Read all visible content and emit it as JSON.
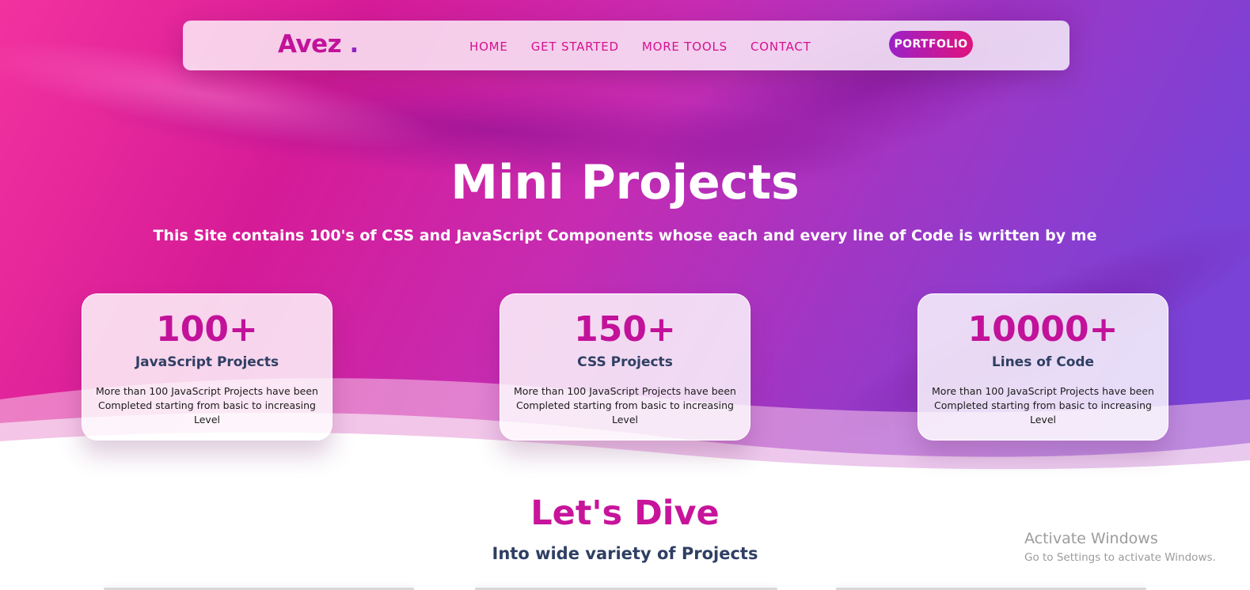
{
  "navbar": {
    "logo_text": "Avez",
    "logo_dot": ".",
    "links": [
      "HOME",
      "GET STARTED",
      "MORE TOOLS",
      "CONTACT"
    ],
    "portfolio_label": "PORTFOLIO"
  },
  "hero": {
    "title": "Mini Projects",
    "subtitle": "This Site contains 100's of CSS and JavaScript Components whose each and every line of Code is written by me"
  },
  "stats": [
    {
      "value": "100+",
      "title": "JavaScript Projects",
      "description": "More than 100 JavaScript Projects have been Completed starting from basic to increasing Level"
    },
    {
      "value": "150+",
      "title": "CSS Projects",
      "description": "More than 100 JavaScript Projects have been Completed starting from basic to increasing Level"
    },
    {
      "value": "10000+",
      "title": "Lines of Code",
      "description": "More than 100 JavaScript Projects have been Completed starting from basic to increasing Level"
    }
  ],
  "dive": {
    "title": "Let's Dive",
    "subtitle": "Into wide variety of Projects"
  },
  "watermark": {
    "title": "Activate Windows",
    "subtitle": "Go to Settings to activate Windows."
  },
  "colors": {
    "accent_pink": "#c2129a",
    "accent_purple": "#8f24c8",
    "heading_navy": "#2f3f63"
  }
}
